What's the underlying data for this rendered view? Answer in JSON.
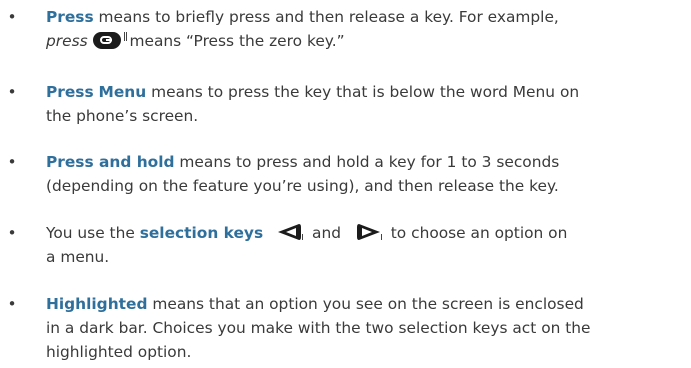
{
  "bullet": "•",
  "items": [
    {
      "term": "Press",
      "line1": " means to briefly press and then release a key. For example,",
      "line2_em": "press",
      "line2_rest": " means “Press the zero key.”"
    },
    {
      "term": "Press",
      "menu_word_blue": "Menu",
      "line1_rest": " means to press the key that is below the word ",
      "menu_word": "Menu",
      "line1_end": " on",
      "line2": "the phone’s screen."
    },
    {
      "term": "Press and hold",
      "line1": " means to press and hold a key for 1 to 3 seconds",
      "line2": "(depending on the feature you’re using), and then release the key."
    },
    {
      "prefix": "You use the ",
      "term": "selection keys",
      "and": " and ",
      "after": " to choose an option on",
      "line2": "a menu."
    },
    {
      "term": "Highlighted",
      "line1": " means that an option you see on the screen is enclosed",
      "line2": "in a dark bar. Choices you make with the two selection keys act on the",
      "line3": "highlighted option."
    }
  ],
  "colors": {
    "text": "#3a3a3a",
    "accent": "#2f6f9c"
  },
  "icons": {
    "zero_key": "zero-key-icon",
    "left_selection_key": "left-selection-key-icon",
    "right_selection_key": "right-selection-key-icon"
  }
}
